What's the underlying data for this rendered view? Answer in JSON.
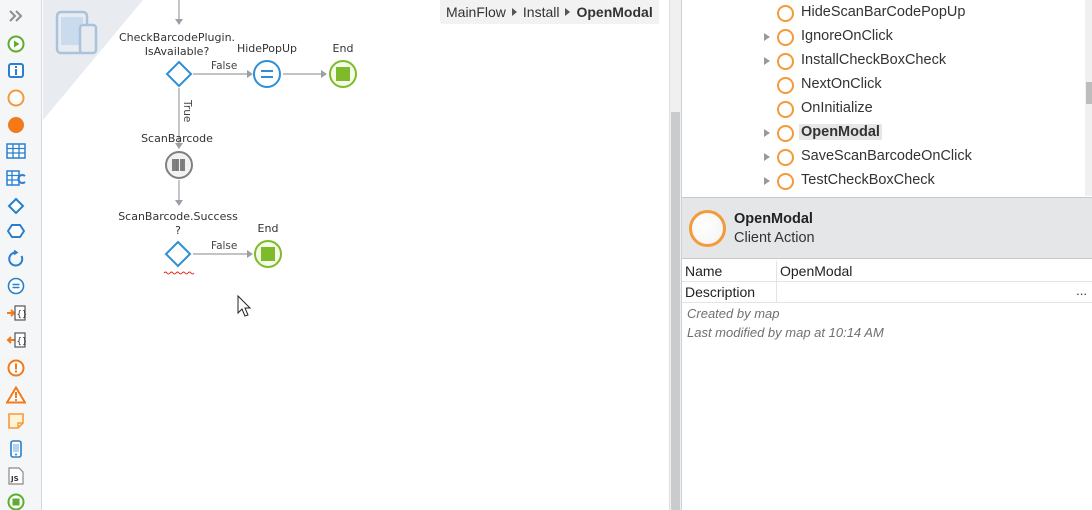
{
  "toolbox": {
    "tools": [
      {
        "icon": "double-chevron-right-icon"
      },
      {
        "icon": "start-icon"
      },
      {
        "icon": "info-icon"
      },
      {
        "icon": "client-action-icon"
      },
      {
        "icon": "server-action-icon"
      },
      {
        "icon": "aggregate-icon"
      },
      {
        "icon": "data-action-icon"
      },
      {
        "icon": "if-icon"
      },
      {
        "icon": "switch-icon"
      },
      {
        "icon": "foreach-icon"
      },
      {
        "icon": "assign-icon"
      },
      {
        "icon": "json-deserialize-icon"
      },
      {
        "icon": "json-serialize-icon"
      },
      {
        "icon": "exception-icon"
      },
      {
        "icon": "raise-error-icon"
      },
      {
        "icon": "comment-icon"
      },
      {
        "icon": "message-icon"
      },
      {
        "icon": "javascript-icon"
      },
      {
        "icon": "end-icon"
      }
    ]
  },
  "breadcrumb": {
    "items": [
      "MainFlow",
      "Install"
    ],
    "current": "OpenModal"
  },
  "flow": {
    "nodes": {
      "check": {
        "label_line1": "CheckBarcodePlugin.",
        "label_line2": "IsAvailable?"
      },
      "hide": {
        "label": "HidePopUp"
      },
      "end1": {
        "label": "End"
      },
      "scan": {
        "label": "ScanBarcode"
      },
      "success": {
        "label_line1": "ScanBarcode.Success",
        "label_line2": "?"
      },
      "end2": {
        "label": "End"
      }
    },
    "edges": {
      "false1": "False",
      "true1": "True",
      "false2": "False"
    }
  },
  "tree": {
    "items": [
      {
        "label": "HideScanBarCodePopUp",
        "expandable": false,
        "selected": false
      },
      {
        "label": "IgnoreOnClick",
        "expandable": true,
        "selected": false
      },
      {
        "label": "InstallCheckBoxCheck",
        "expandable": true,
        "selected": false
      },
      {
        "label": "NextOnClick",
        "expandable": false,
        "selected": false
      },
      {
        "label": "OnInitialize",
        "expandable": false,
        "selected": false
      },
      {
        "label": "OpenModal",
        "expandable": true,
        "selected": true
      },
      {
        "label": "SaveScanBarcodeOnClick",
        "expandable": true,
        "selected": false
      },
      {
        "label": "TestCheckBoxCheck",
        "expandable": true,
        "selected": false
      }
    ]
  },
  "properties": {
    "title": "OpenModal",
    "subtitle": "Client Action",
    "rows": [
      {
        "key": "Name",
        "value": "OpenModal"
      },
      {
        "key": "Description",
        "value": "",
        "ellipsis": "..."
      }
    ],
    "created": "Created by map",
    "modified": "Last modified by map at 10:14 AM"
  },
  "colors": {
    "action_orange": "#f39a3a",
    "end_green": "#7dbb2a",
    "decision_blue": "#2f8fd6",
    "tool_green": "#5cae2c",
    "tool_blue": "#2a7fcf"
  }
}
